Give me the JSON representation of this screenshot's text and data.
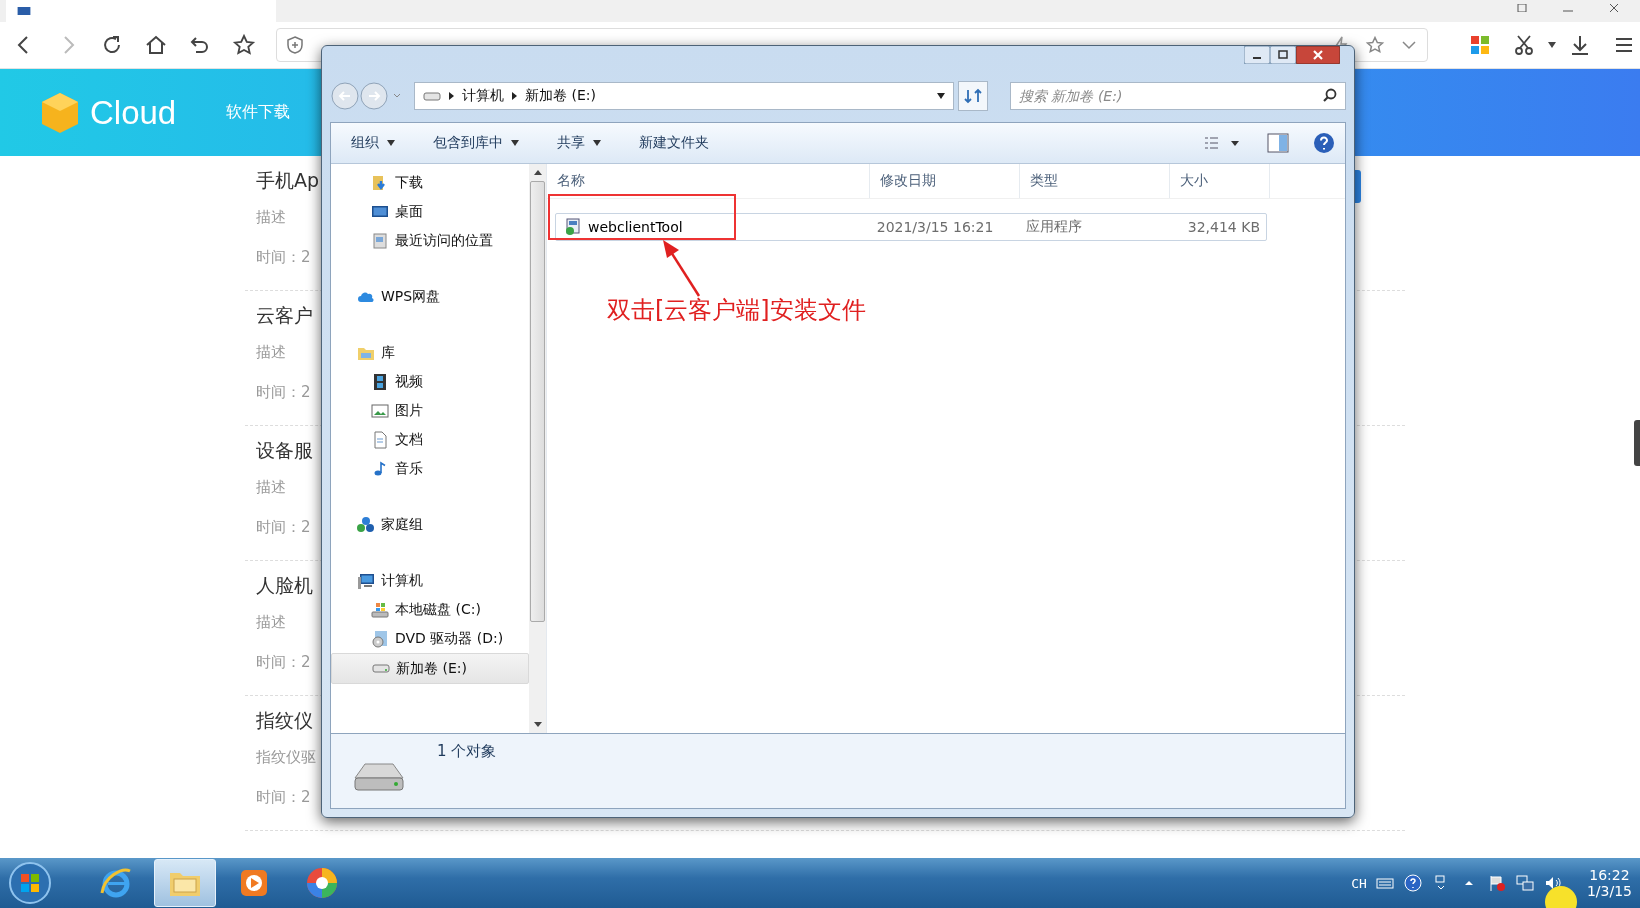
{
  "page": {
    "logo": "Cloud",
    "nav": [
      "软件下载"
    ],
    "items": [
      {
        "title": "手机Ap",
        "description": "描述",
        "time": "时间：2"
      },
      {
        "title": "云客户",
        "description": "描述",
        "time": "时间：2"
      },
      {
        "title": "设备服",
        "description": "描述",
        "time": "时间：2"
      },
      {
        "title": "人脸机",
        "description": "描述",
        "time": "时间：2"
      },
      {
        "title": "指纹仪",
        "description": "指纹仪驱",
        "time": "时间：2"
      }
    ]
  },
  "explorer": {
    "breadcrumb": [
      "计算机",
      "新加卷 (E:)"
    ],
    "search": {
      "placeholder": "搜索 新加卷 (E:)"
    },
    "toolbar": [
      {
        "label": "组织",
        "dropdown": true
      },
      {
        "label": "包含到库中",
        "dropdown": true
      },
      {
        "label": "共享",
        "dropdown": true
      },
      {
        "label": "新建文件夹",
        "dropdown": false
      }
    ],
    "nav_pane": [
      {
        "children": [
          {
            "label": "下载",
            "kind": "downloads",
            "selected": false
          },
          {
            "label": "桌面",
            "kind": "desktop",
            "selected": false
          },
          {
            "label": "最近访问的位置",
            "kind": "recent",
            "selected": false
          }
        ]
      },
      {
        "label": "WPS网盘",
        "kind": "cloud",
        "selected": false
      },
      {
        "label": "库",
        "kind": "library",
        "selected": false,
        "children": [
          {
            "label": "视频",
            "kind": "video",
            "selected": false
          },
          {
            "label": "图片",
            "kind": "picture",
            "selected": false
          },
          {
            "label": "文档",
            "kind": "document",
            "selected": false
          },
          {
            "label": "音乐",
            "kind": "music",
            "selected": false
          }
        ]
      },
      {
        "label": "家庭组",
        "kind": "homegroup",
        "selected": false
      },
      {
        "label": "计算机",
        "kind": "computer",
        "selected": false,
        "children": [
          {
            "label": "本地磁盘 (C:)",
            "kind": "system-drive",
            "selected": false
          },
          {
            "label": "DVD 驱动器 (D:)",
            "kind": "dvd",
            "selected": false
          },
          {
            "label": "新加卷 (E:)",
            "kind": "drive",
            "selected": true
          }
        ]
      }
    ],
    "columns": [
      "名称",
      "修改日期",
      "类型",
      "大小"
    ],
    "files": [
      {
        "name": "webclientTool",
        "date": "2021/3/15 16:21",
        "type": "应用程序",
        "size": "32,414 KB"
      }
    ],
    "status": "1 个对象"
  },
  "annotation": {
    "text": "双击[云客户端]安装文件"
  },
  "taskbar": {
    "apps": [
      {
        "kind": "ie",
        "active": false
      },
      {
        "kind": "explorer",
        "active": true
      },
      {
        "kind": "media",
        "active": false
      },
      {
        "kind": "browser",
        "active": false
      }
    ],
    "tray": {
      "language": "CH",
      "time": "16:22",
      "date": "1/3/15"
    }
  }
}
